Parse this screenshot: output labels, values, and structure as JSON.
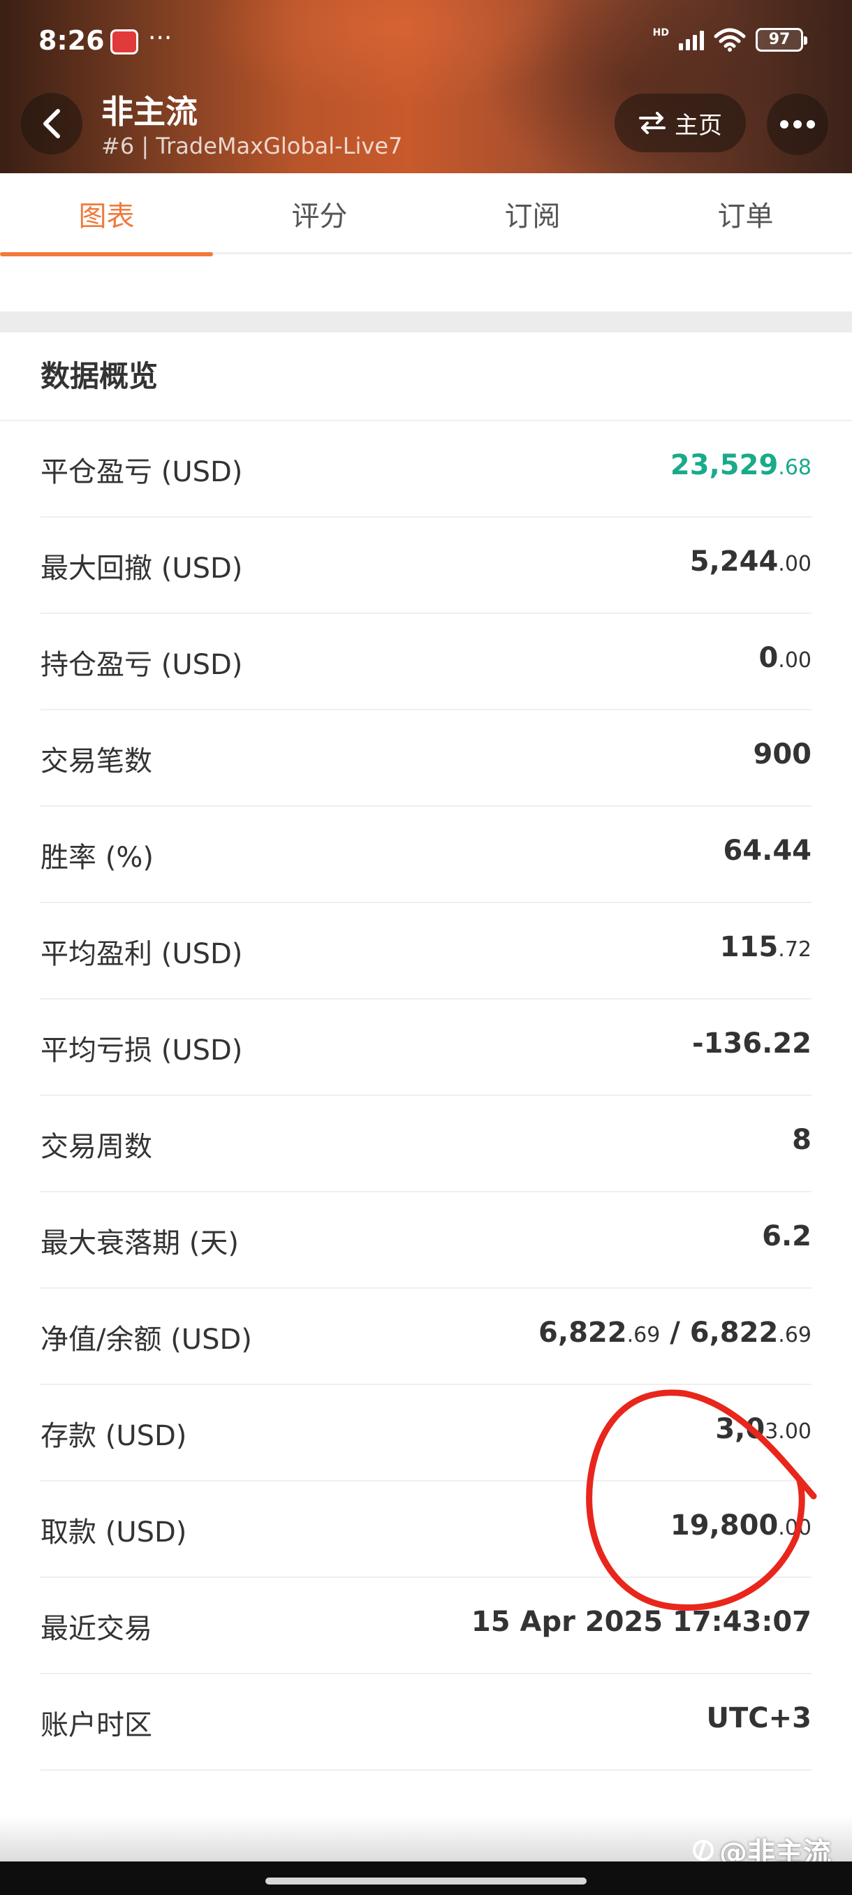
{
  "status_bar": {
    "time": "8:26",
    "dots": "···",
    "hd": "HD",
    "battery": "97"
  },
  "header": {
    "title": "非主流",
    "subtitle": "#6 | TradeMaxGlobal-Live7",
    "home_label": "主页"
  },
  "tabs": [
    {
      "label": "图表",
      "active": true
    },
    {
      "label": "评分",
      "active": false
    },
    {
      "label": "订阅",
      "active": false
    },
    {
      "label": "订单",
      "active": false
    }
  ],
  "overview": {
    "title": "数据概览",
    "rows": [
      {
        "label": "平仓盈亏 (USD)",
        "int": "23,529",
        "dec": ".68"
      },
      {
        "label": "最大回撤 (USD)",
        "int": "5,244",
        "dec": ".00"
      },
      {
        "label": "持仓盈亏 (USD)",
        "int": "0",
        "dec": ".00"
      },
      {
        "label": "交易笔数",
        "int": "900",
        "dec": ""
      },
      {
        "label": "胜率 (%)",
        "int": "64.44",
        "dec": ""
      },
      {
        "label": "平均盈利 (USD)",
        "int": "115",
        "dec": ".72"
      },
      {
        "label": "平均亏损 (USD)",
        "int": "-136.22",
        "dec": ""
      },
      {
        "label": "交易周数",
        "int": "8",
        "dec": ""
      },
      {
        "label": "最大衰落期 (天)",
        "int": "6.2",
        "dec": ""
      },
      {
        "label": "净值/余额 (USD)",
        "int": "6,822",
        "dec": ".69",
        "int2": " / 6,822",
        "dec2": ".69"
      },
      {
        "label": "存款 (USD)",
        "int": "3,0",
        "dec": "3.00"
      },
      {
        "label": "取款 (USD)",
        "int": "19,800",
        "dec": ".00"
      },
      {
        "label": "最近交易",
        "int": "15 Apr 2025 17:43:07",
        "dec": ""
      },
      {
        "label": "账户时区",
        "int": "UTC+3",
        "dec": ""
      }
    ]
  },
  "watermark": "@非主流",
  "colors": {
    "accent": "#f07a3c",
    "positive": "#1aaa8a",
    "annotation": "#e8261c"
  }
}
